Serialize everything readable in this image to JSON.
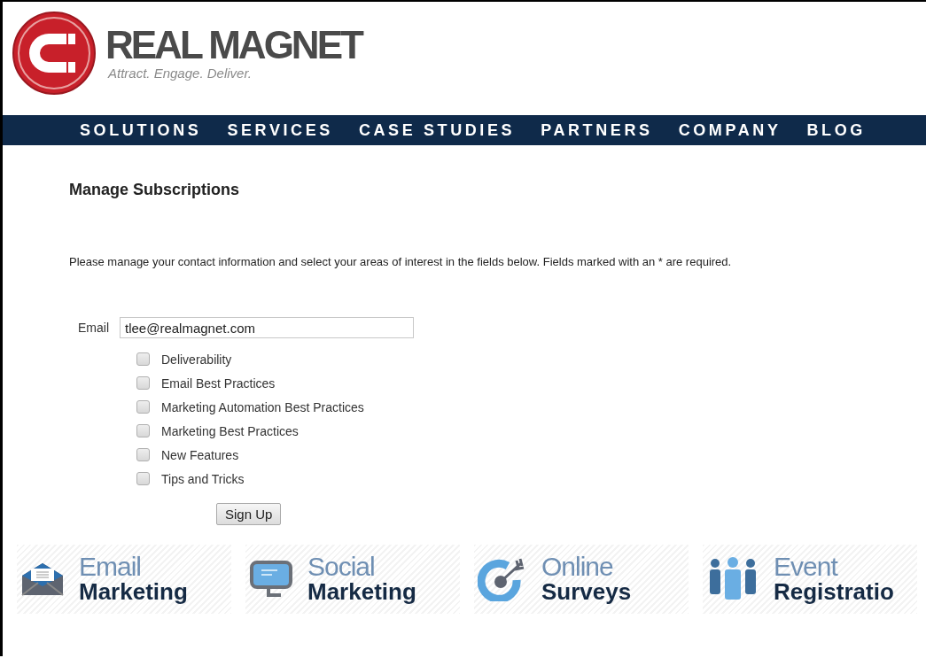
{
  "logo": {
    "name": "REAL MAGNET",
    "tagline": "Attract. Engage. Deliver."
  },
  "nav": [
    "SOLUTIONS",
    "SERVICES",
    "CASE STUDIES",
    "PARTNERS",
    "COMPANY",
    "BLOG"
  ],
  "title": "Manage Subscriptions",
  "intro": "Please manage your contact information and select your areas of interest in the fields below. Fields marked with an * are required.",
  "email": {
    "label": "Email",
    "value": "tlee@realmagnet.com"
  },
  "interests": [
    {
      "label": "Deliverability",
      "checked": false
    },
    {
      "label": "Email Best Practices",
      "checked": false
    },
    {
      "label": "Marketing Automation Best Practices",
      "checked": false
    },
    {
      "label": "Marketing Best Practices",
      "checked": false
    },
    {
      "label": "New Features",
      "checked": false
    },
    {
      "label": "Tips and Tricks",
      "checked": false
    }
  ],
  "submit": "Sign Up",
  "banners": [
    {
      "kind": "email",
      "top": "Email",
      "bottom": "Marketing"
    },
    {
      "kind": "social",
      "top": "Social",
      "bottom": "Marketing"
    },
    {
      "kind": "survey",
      "top": "Online",
      "bottom": "Surveys"
    },
    {
      "kind": "event",
      "top": "Event",
      "bottom": "Registratio"
    }
  ]
}
